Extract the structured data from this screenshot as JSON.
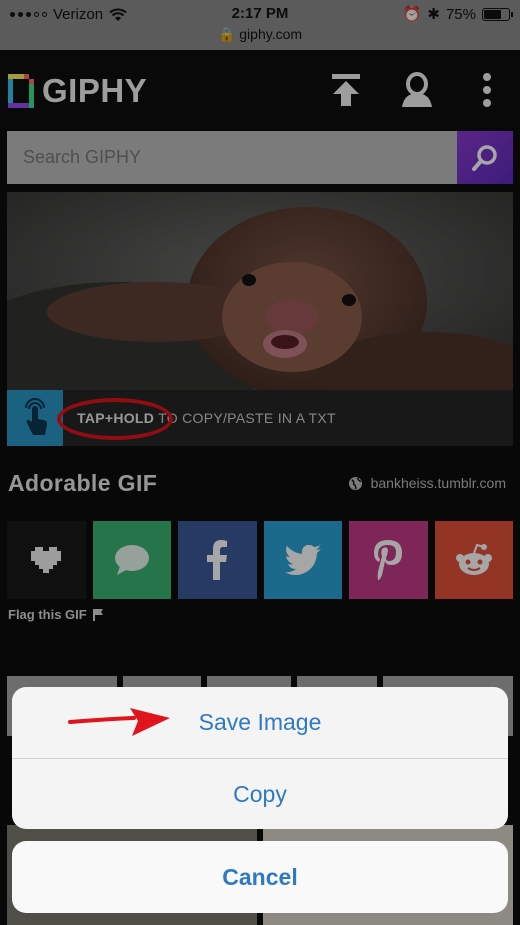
{
  "status_bar": {
    "carrier": "Verizon",
    "time": "2:17 PM",
    "url": "giphy.com",
    "battery": "75%",
    "battery_level": 0.75
  },
  "header": {
    "logo_text": "GIPHY",
    "icons": [
      "upload-icon",
      "user-icon",
      "more-vertical-icon"
    ]
  },
  "search": {
    "placeholder": "Search GIPHY"
  },
  "gif": {
    "tap_label": "TAP+HOLD",
    "tap_rest": " TO COPY/PASTE IN A TXT"
  },
  "gif_title": "Adorable GIF",
  "source": "bankheiss.tumblr.com",
  "share": [
    {
      "name": "favorite",
      "color": "#1a1a1a",
      "icon": "heart-icon"
    },
    {
      "name": "sms",
      "color": "#3bb272",
      "icon": "chat-bubble-icon"
    },
    {
      "name": "facebook",
      "color": "#3b5a9a",
      "icon": "facebook-icon"
    },
    {
      "name": "twitter",
      "color": "#2aa3d6",
      "icon": "twitter-icon"
    },
    {
      "name": "pinterest",
      "color": "#c13b86",
      "icon": "pinterest-icon"
    },
    {
      "name": "reddit",
      "color": "#e4503a",
      "icon": "reddit-icon"
    }
  ],
  "flag_label": "Flag this GIF",
  "action_sheet": {
    "save": "Save Image",
    "copy": "Copy",
    "cancel": "Cancel"
  },
  "colors": {
    "accent_blue": "#2e7ac2",
    "annotation_red": "#e0141c"
  }
}
